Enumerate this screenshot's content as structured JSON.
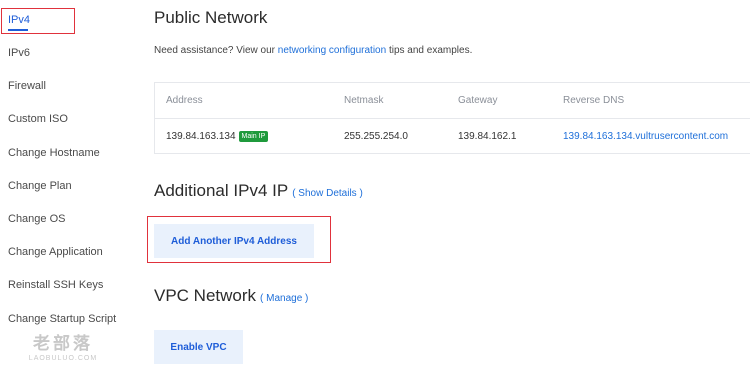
{
  "sidebar": {
    "items": [
      {
        "label": "IPv4",
        "active": true
      },
      {
        "label": "IPv6"
      },
      {
        "label": "Firewall"
      },
      {
        "label": "Custom ISO"
      },
      {
        "label": "Change Hostname"
      },
      {
        "label": "Change Plan"
      },
      {
        "label": "Change OS"
      },
      {
        "label": "Change Application"
      },
      {
        "label": "Reinstall SSH Keys"
      },
      {
        "label": "Change Startup Script"
      }
    ]
  },
  "watermark": {
    "text": "老部落",
    "subtext": "LAOBULUO.COM"
  },
  "public_network": {
    "title": "Public Network",
    "assist_prefix": "Need assistance? View our ",
    "assist_link": "networking configuration",
    "assist_suffix": " tips and examples.",
    "table": {
      "headers": [
        "Address",
        "Netmask",
        "Gateway",
        "Reverse DNS"
      ],
      "row": {
        "address": "139.84.163.134",
        "badge": "Main IP",
        "netmask": "255.255.254.0",
        "gateway": "139.84.162.1",
        "reverse_dns": "139.84.163.134.vultrusercontent.com"
      }
    }
  },
  "additional_ipv4": {
    "title": "Additional IPv4 IP",
    "link": "( Show Details )",
    "button": "Add Another IPv4 Address"
  },
  "vpc": {
    "title": "VPC Network",
    "link": "( Manage )",
    "button": "Enable VPC"
  }
}
